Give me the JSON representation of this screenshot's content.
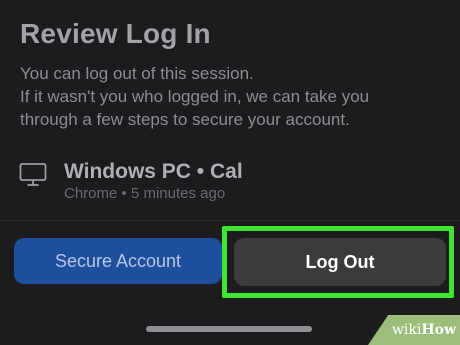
{
  "review": {
    "title": "Review Log In",
    "description_line1": "You can log out of this session.",
    "description_line2": "If it wasn't you who logged in, we can take you",
    "description_line3": "through a few steps to secure your account."
  },
  "session": {
    "device_icon": "monitor-icon",
    "device": "Windows PC • Cal",
    "meta": "Chrome • 5 minutes ago"
  },
  "actions": {
    "secure_label": "Secure Account",
    "logout_label": "Log Out"
  },
  "watermark": {
    "wiki": "wiki",
    "how": "How"
  },
  "colors": {
    "background": "#1c1c1e",
    "secure_button": "#1d4f9d",
    "logout_button": "#3b3b3e",
    "highlight": "#3ee62f"
  }
}
